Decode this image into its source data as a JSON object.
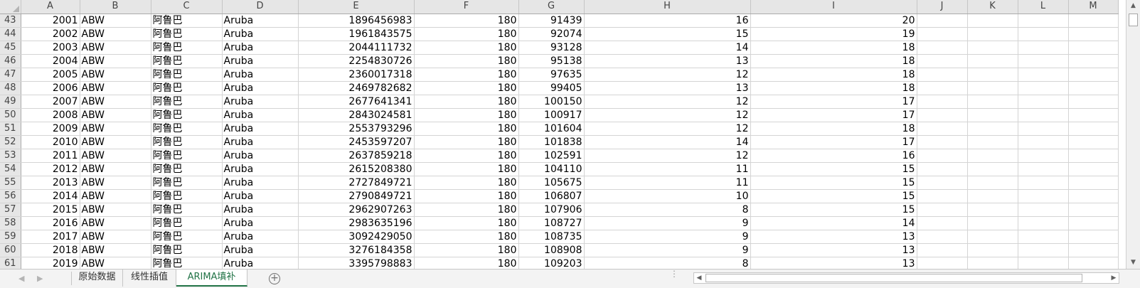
{
  "columns": [
    "A",
    "B",
    "C",
    "D",
    "E",
    "F",
    "G",
    "H",
    "I",
    "J",
    "K",
    "L",
    "M"
  ],
  "rows": [
    {
      "n": "43",
      "A": "2001",
      "B": "ABW",
      "C": "阿鲁巴",
      "D": "Aruba",
      "E": "1896456983",
      "F": "180",
      "G": "91439",
      "H": "16",
      "I": "20"
    },
    {
      "n": "44",
      "A": "2002",
      "B": "ABW",
      "C": "阿鲁巴",
      "D": "Aruba",
      "E": "1961843575",
      "F": "180",
      "G": "92074",
      "H": "15",
      "I": "19"
    },
    {
      "n": "45",
      "A": "2003",
      "B": "ABW",
      "C": "阿鲁巴",
      "D": "Aruba",
      "E": "2044111732",
      "F": "180",
      "G": "93128",
      "H": "14",
      "I": "18"
    },
    {
      "n": "46",
      "A": "2004",
      "B": "ABW",
      "C": "阿鲁巴",
      "D": "Aruba",
      "E": "2254830726",
      "F": "180",
      "G": "95138",
      "H": "13",
      "I": "18"
    },
    {
      "n": "47",
      "A": "2005",
      "B": "ABW",
      "C": "阿鲁巴",
      "D": "Aruba",
      "E": "2360017318",
      "F": "180",
      "G": "97635",
      "H": "12",
      "I": "18"
    },
    {
      "n": "48",
      "A": "2006",
      "B": "ABW",
      "C": "阿鲁巴",
      "D": "Aruba",
      "E": "2469782682",
      "F": "180",
      "G": "99405",
      "H": "13",
      "I": "18"
    },
    {
      "n": "49",
      "A": "2007",
      "B": "ABW",
      "C": "阿鲁巴",
      "D": "Aruba",
      "E": "2677641341",
      "F": "180",
      "G": "100150",
      "H": "12",
      "I": "17"
    },
    {
      "n": "50",
      "A": "2008",
      "B": "ABW",
      "C": "阿鲁巴",
      "D": "Aruba",
      "E": "2843024581",
      "F": "180",
      "G": "100917",
      "H": "12",
      "I": "17"
    },
    {
      "n": "51",
      "A": "2009",
      "B": "ABW",
      "C": "阿鲁巴",
      "D": "Aruba",
      "E": "2553793296",
      "F": "180",
      "G": "101604",
      "H": "12",
      "I": "18"
    },
    {
      "n": "52",
      "A": "2010",
      "B": "ABW",
      "C": "阿鲁巴",
      "D": "Aruba",
      "E": "2453597207",
      "F": "180",
      "G": "101838",
      "H": "14",
      "I": "17"
    },
    {
      "n": "53",
      "A": "2011",
      "B": "ABW",
      "C": "阿鲁巴",
      "D": "Aruba",
      "E": "2637859218",
      "F": "180",
      "G": "102591",
      "H": "12",
      "I": "16"
    },
    {
      "n": "54",
      "A": "2012",
      "B": "ABW",
      "C": "阿鲁巴",
      "D": "Aruba",
      "E": "2615208380",
      "F": "180",
      "G": "104110",
      "H": "11",
      "I": "15"
    },
    {
      "n": "55",
      "A": "2013",
      "B": "ABW",
      "C": "阿鲁巴",
      "D": "Aruba",
      "E": "2727849721",
      "F": "180",
      "G": "105675",
      "H": "11",
      "I": "15"
    },
    {
      "n": "56",
      "A": "2014",
      "B": "ABW",
      "C": "阿鲁巴",
      "D": "Aruba",
      "E": "2790849721",
      "F": "180",
      "G": "106807",
      "H": "10",
      "I": "15"
    },
    {
      "n": "57",
      "A": "2015",
      "B": "ABW",
      "C": "阿鲁巴",
      "D": "Aruba",
      "E": "2962907263",
      "F": "180",
      "G": "107906",
      "H": "8",
      "I": "15"
    },
    {
      "n": "58",
      "A": "2016",
      "B": "ABW",
      "C": "阿鲁巴",
      "D": "Aruba",
      "E": "2983635196",
      "F": "180",
      "G": "108727",
      "H": "9",
      "I": "14"
    },
    {
      "n": "59",
      "A": "2017",
      "B": "ABW",
      "C": "阿鲁巴",
      "D": "Aruba",
      "E": "3092429050",
      "F": "180",
      "G": "108735",
      "H": "9",
      "I": "13"
    },
    {
      "n": "60",
      "A": "2018",
      "B": "ABW",
      "C": "阿鲁巴",
      "D": "Aruba",
      "E": "3276184358",
      "F": "180",
      "G": "108908",
      "H": "9",
      "I": "13"
    },
    {
      "n": "61",
      "A": "2019",
      "B": "ABW",
      "C": "阿鲁巴",
      "D": "Aruba",
      "E": "3395798883",
      "F": "180",
      "G": "109203",
      "H": "8",
      "I": "13"
    }
  ],
  "sheet_tabs": [
    {
      "label": "原始数据",
      "active": false
    },
    {
      "label": "线性插值",
      "active": false
    },
    {
      "label": "ARIMA填补",
      "active": true
    }
  ],
  "icons": {
    "nav_prev": "◀",
    "nav_next": "▶",
    "add_sheet": "+",
    "scroll_up": "▲",
    "scroll_down": "▼",
    "scroll_left": "◀",
    "scroll_right": "▶",
    "split": "⋮"
  },
  "colors": {
    "active_tab": "#217346",
    "header_bg": "#e6e6e6",
    "grid_line": "#d4d4d4"
  }
}
